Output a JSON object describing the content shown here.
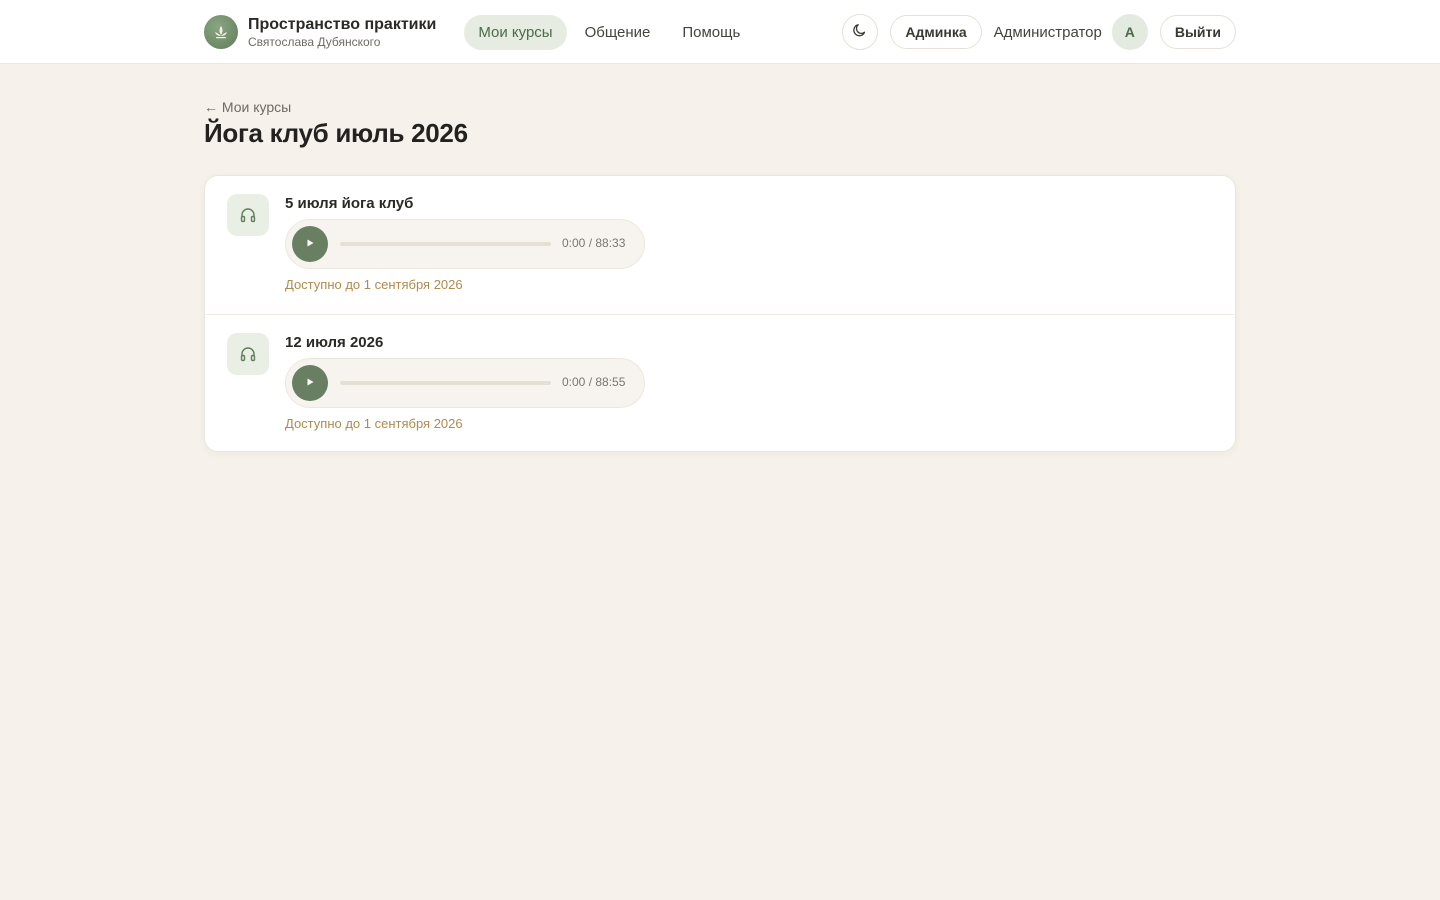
{
  "header": {
    "brand_title": "Пространство практики",
    "brand_subtitle": "Святослава Дубянского",
    "nav": [
      {
        "label": "Мои курсы",
        "active": true
      },
      {
        "label": "Общение",
        "active": false
      },
      {
        "label": "Помощь",
        "active": false
      }
    ],
    "theme_icon": "moon-icon",
    "admin_button": "Админка",
    "user_name": "Администратор",
    "avatar_initial": "А",
    "logout_button": "Выйти"
  },
  "page": {
    "back_link": "← Мои курсы",
    "title": "Йога клуб июль 2026"
  },
  "lessons": [
    {
      "title": "5 июля йога клуб",
      "time": "0:00 / 88:33",
      "progress": 0,
      "availability": "Доступно до 1 сентября 2026"
    },
    {
      "title": "12 июля 2026",
      "time": "0:00 / 88:55",
      "progress": 0,
      "availability": "Доступно до 1 сентября 2026"
    }
  ],
  "colors": {
    "accent": "#687f61",
    "background": "#f6f2eb",
    "availability_text": "#b08a4e"
  }
}
